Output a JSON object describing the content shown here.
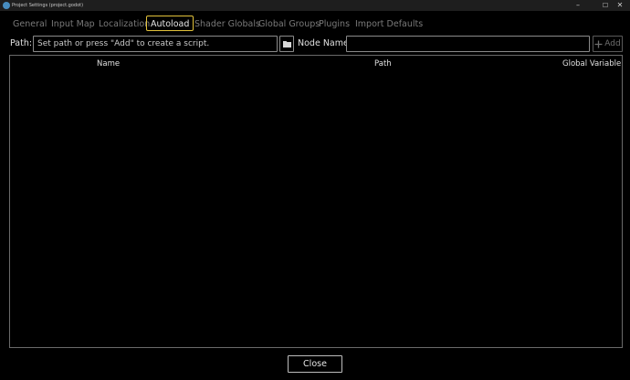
{
  "window": {
    "title": "Project Settings (project.godot)",
    "minimize_glyph": "–",
    "maximize_glyph": "☐",
    "close_glyph": "✕"
  },
  "tabs": [
    {
      "label": "General",
      "active": false
    },
    {
      "label": "Input Map",
      "active": false
    },
    {
      "label": "Localization",
      "active": false
    },
    {
      "label": "Autoload",
      "active": true
    },
    {
      "label": "Shader Globals",
      "active": false
    },
    {
      "label": "Global Groups",
      "active": false
    },
    {
      "label": "Plugins",
      "active": false
    },
    {
      "label": "Import Defaults",
      "active": false
    }
  ],
  "autoload": {
    "path_label": "Path:",
    "path_placeholder": "Set path or press \"Add\" to create a script.",
    "node_name_label": "Node Name:",
    "node_name_value": "",
    "add_label": "Add",
    "columns": {
      "name": "Name",
      "path": "Path",
      "global_variable": "Global Variable"
    }
  },
  "footer": {
    "close_label": "Close"
  },
  "colors": {
    "background": "#000000",
    "active_tab_border": "#e2c23b",
    "inactive_tab_text": "#7a7a7a",
    "app_icon": "#478cbf"
  },
  "icons": {
    "app": "godot-app-icon",
    "browse": "folder-icon",
    "add": "plus-icon"
  }
}
